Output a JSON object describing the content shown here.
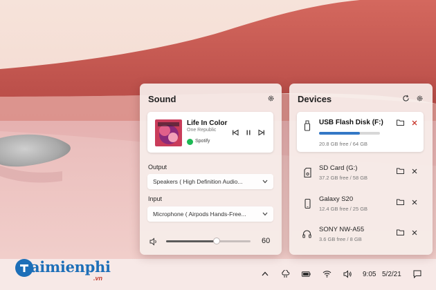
{
  "sound_panel": {
    "title": "Sound",
    "media": {
      "title": "Life In Color",
      "artist": "One Republic",
      "service": "Spotify"
    },
    "output_label": "Output",
    "output_value": "Speakers ( High Definition Audio...",
    "input_label": "Input",
    "input_value": "Microphone ( Airpods Hands-Free...",
    "volume": {
      "value": "60",
      "level": 0.6
    }
  },
  "devices_panel": {
    "title": "Devices",
    "devices": [
      {
        "name": "USB Flash Disk (F:)",
        "free": "20.8 GB free / 64 GB",
        "icon": "usb-drive-icon",
        "usage": 0.675
      },
      {
        "name": "SD Card (G:)",
        "free": "37.2 GB free / 58 GB",
        "icon": "sd-card-icon"
      },
      {
        "name": "Galaxy S20",
        "free": "12.4 GB free / 25 GB",
        "icon": "phone-icon"
      },
      {
        "name": "SONY NW-A55",
        "free": "3.6 GB free / 8 GB",
        "icon": "headphones-icon"
      }
    ]
  },
  "taskbar": {
    "time": "9:05",
    "date": "5/2/21"
  },
  "watermark": {
    "text": "aimienphi",
    "sub": ".vn"
  },
  "colors": {
    "accent": "#3478c6",
    "spotify": "#1db954",
    "close_red": "#c8382e"
  }
}
